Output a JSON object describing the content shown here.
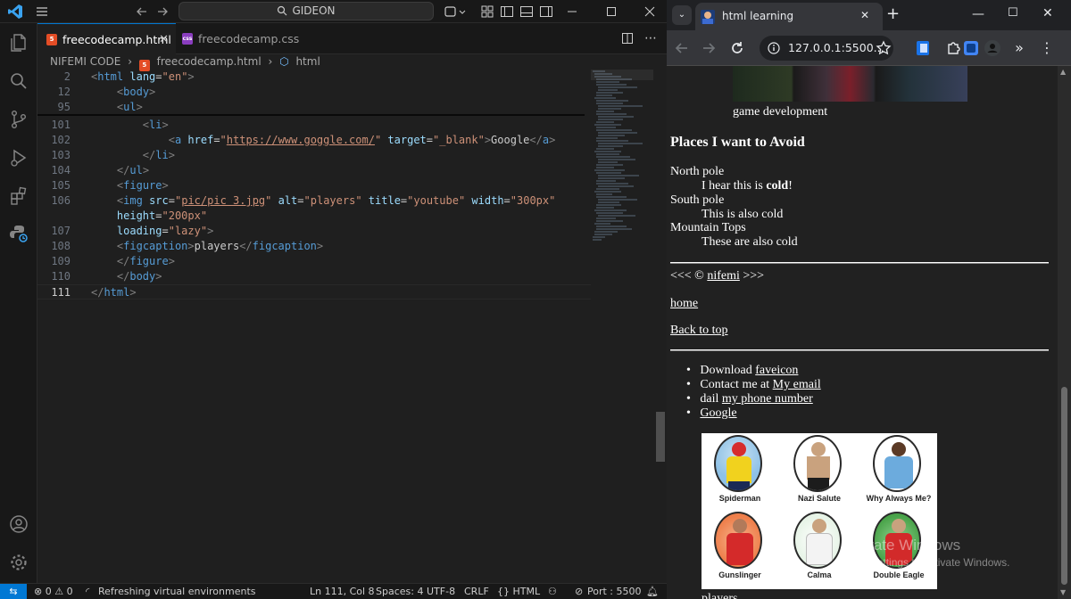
{
  "vscode": {
    "search_text": "GIDEON",
    "tabs": [
      {
        "label": "freecodecamp.html",
        "badge": "5",
        "badge_color": "#e44d26",
        "active": true
      },
      {
        "label": "freecodecamp.css",
        "badge": "css",
        "badge_color": "#8a3dbf",
        "active": false
      }
    ],
    "breadcrumb": {
      "folder": "NIFEMI CODE",
      "file": "freecodecamp.html",
      "symbol": "html"
    },
    "line_numbers": [
      "2",
      "12",
      "95",
      "101",
      "102",
      "103",
      "104",
      "105",
      "106",
      "",
      "107",
      "108",
      "109",
      "110",
      "111"
    ],
    "status": {
      "remote": "⇆",
      "problems": "⊗ 0 ⚠ 0",
      "task": "Refreshing virtual environments",
      "position": "Ln 111, Col 8",
      "spaces": "Spaces: 4",
      "encoding": "UTF-8",
      "eol": "CRLF",
      "language": "{} HTML",
      "port": "Port : 5500"
    }
  },
  "browser": {
    "tab_title": "html learning",
    "new_tab": "+",
    "url": "127.0.0.1:5500...",
    "page": {
      "game_caption": "game development",
      "places_heading": "Places I want to Avoid",
      "places": [
        {
          "term": "North pole",
          "desc_pre": "I hear this is ",
          "desc_bold": "cold",
          "desc_post": "!"
        },
        {
          "term": "South pole",
          "desc_pre": "This is also cold",
          "desc_bold": "",
          "desc_post": ""
        },
        {
          "term": "Mountain Tops",
          "desc_pre": "These are also cold",
          "desc_bold": "",
          "desc_post": ""
        }
      ],
      "copyright_pre": "<<< © ",
      "copyright_link": "nifemi",
      "copyright_post": " >>>",
      "home_link": "home",
      "back_to_top": "Back to top",
      "list": [
        {
          "pre": "Download ",
          "link": "faveicon"
        },
        {
          "pre": "Contact me at ",
          "link": "My email"
        },
        {
          "pre": "dail ",
          "link": "my phone number"
        },
        {
          "pre": "",
          "link": "Google"
        }
      ],
      "players": [
        {
          "name": "Spiderman",
          "color": "#e23c3c"
        },
        {
          "name": "Nazi Salute",
          "color": "#f1f1f1"
        },
        {
          "name": "Why Always Me?",
          "color": "#6cabdd"
        },
        {
          "name": "Gunslinger",
          "color": "#e25b2a"
        },
        {
          "name": "Calma",
          "color": "#f1f1f1"
        },
        {
          "name": "Double Eagle",
          "color": "#4caf50"
        }
      ],
      "figcaption": "players"
    },
    "watermark_title": "Activate Windows",
    "watermark_sub": "Go to Settings to activate Windows."
  }
}
